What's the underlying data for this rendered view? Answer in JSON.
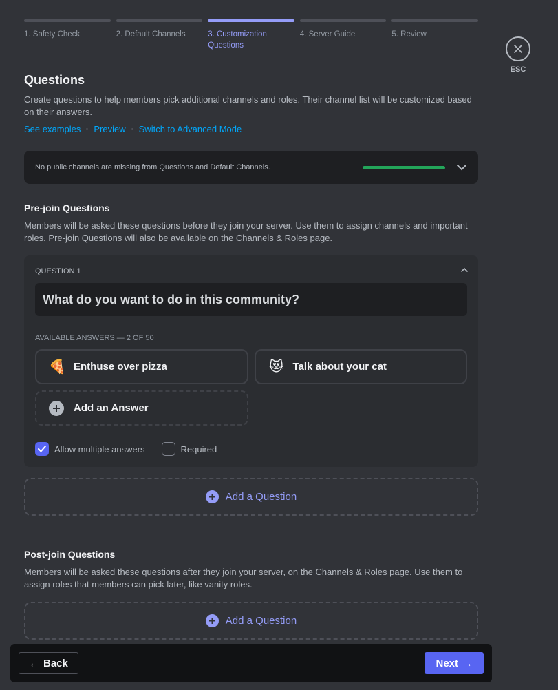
{
  "steps": [
    {
      "label": "1. Safety Check",
      "active": false
    },
    {
      "label": "2. Default Channels",
      "active": false
    },
    {
      "label": "3. Customization Questions",
      "active": true
    },
    {
      "label": "4. Server Guide",
      "active": false
    },
    {
      "label": "5. Review",
      "active": false
    }
  ],
  "close": {
    "label": "ESC"
  },
  "header": {
    "title": "Questions",
    "description": "Create questions to help members pick additional channels and roles. Their channel list will be customized based on their answers.",
    "links": [
      "See examples",
      "Preview",
      "Switch to Advanced Mode"
    ]
  },
  "status": {
    "text": "No public channels are missing from Questions and Default Channels.",
    "progress_percent": 100,
    "color": "#23a55a"
  },
  "prejoin": {
    "title": "Pre-join Questions",
    "description": "Members will be asked these questions before they join your server. Use them to assign channels and important roles. Pre-join Questions will also be available on the Channels & Roles page.",
    "question": {
      "label": "QUESTION 1",
      "value": "What do you want to do in this community?",
      "answers_label": "AVAILABLE ANSWERS — 2 OF 50",
      "answers": [
        {
          "emoji": "🍕",
          "text": "Enthuse over pizza"
        },
        {
          "emoji": "😻",
          "text": "Talk about your cat"
        }
      ],
      "add_answer": "Add an Answer",
      "allow_multiple": {
        "label": "Allow multiple answers",
        "checked": true
      },
      "required": {
        "label": "Required",
        "checked": false
      }
    },
    "add_question": "Add a Question"
  },
  "postjoin": {
    "title": "Post-join Questions",
    "description": "Members will be asked these questions after they join your server, on the Channels & Roles page. Use them to assign roles that members can pick later, like vanity roles.",
    "add_question": "Add a Question"
  },
  "footer": {
    "back": "Back",
    "next": "Next",
    "back_arrow": "←",
    "next_arrow": "→"
  },
  "colors": {
    "accent": "#5865f2",
    "active_step": "#949cf7",
    "link": "#00a8fc",
    "success": "#23a55a"
  }
}
